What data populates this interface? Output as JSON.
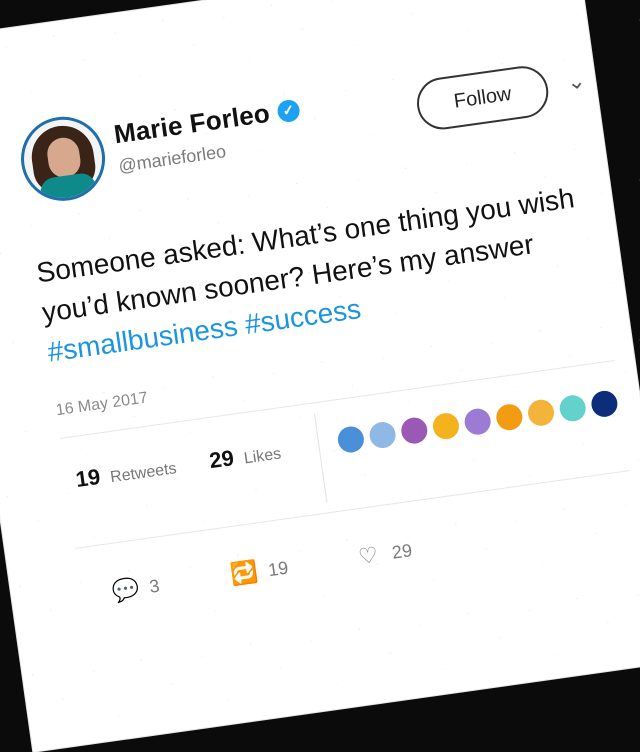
{
  "user": {
    "name": "Marie Forleo",
    "handle": "@marieforleo",
    "verified_icon": "verified-check-icon"
  },
  "header": {
    "follow_label": "Follow",
    "menu_icon": "chevron-down-icon"
  },
  "tweet": {
    "text_prefix": "Someone asked: What’s one thing you wish you’d known sooner? Here’s my answer ",
    "hashtags": [
      "#smallbusiness",
      "#success"
    ],
    "date": "16 May 2017"
  },
  "stats": {
    "retweets": {
      "count": "19",
      "label": "Retweets"
    },
    "likes": {
      "count": "29",
      "label": "Likes"
    }
  },
  "likers": {
    "colors": [
      "#4a90d9",
      "#8fb8e6",
      "#9b59b6",
      "#f5b21f",
      "#9b7bd3",
      "#f39c12",
      "#f4b33a",
      "#63d1cc",
      "#0b2d7a"
    ]
  },
  "actions": {
    "reply": {
      "icon": "reply-icon",
      "count": "3"
    },
    "retweet": {
      "icon": "retweet-icon",
      "count": "19"
    },
    "like": {
      "icon": "heart-icon",
      "count": "29"
    }
  },
  "colors": {
    "link": "#1b95e0",
    "verified": "#1da1f2"
  }
}
